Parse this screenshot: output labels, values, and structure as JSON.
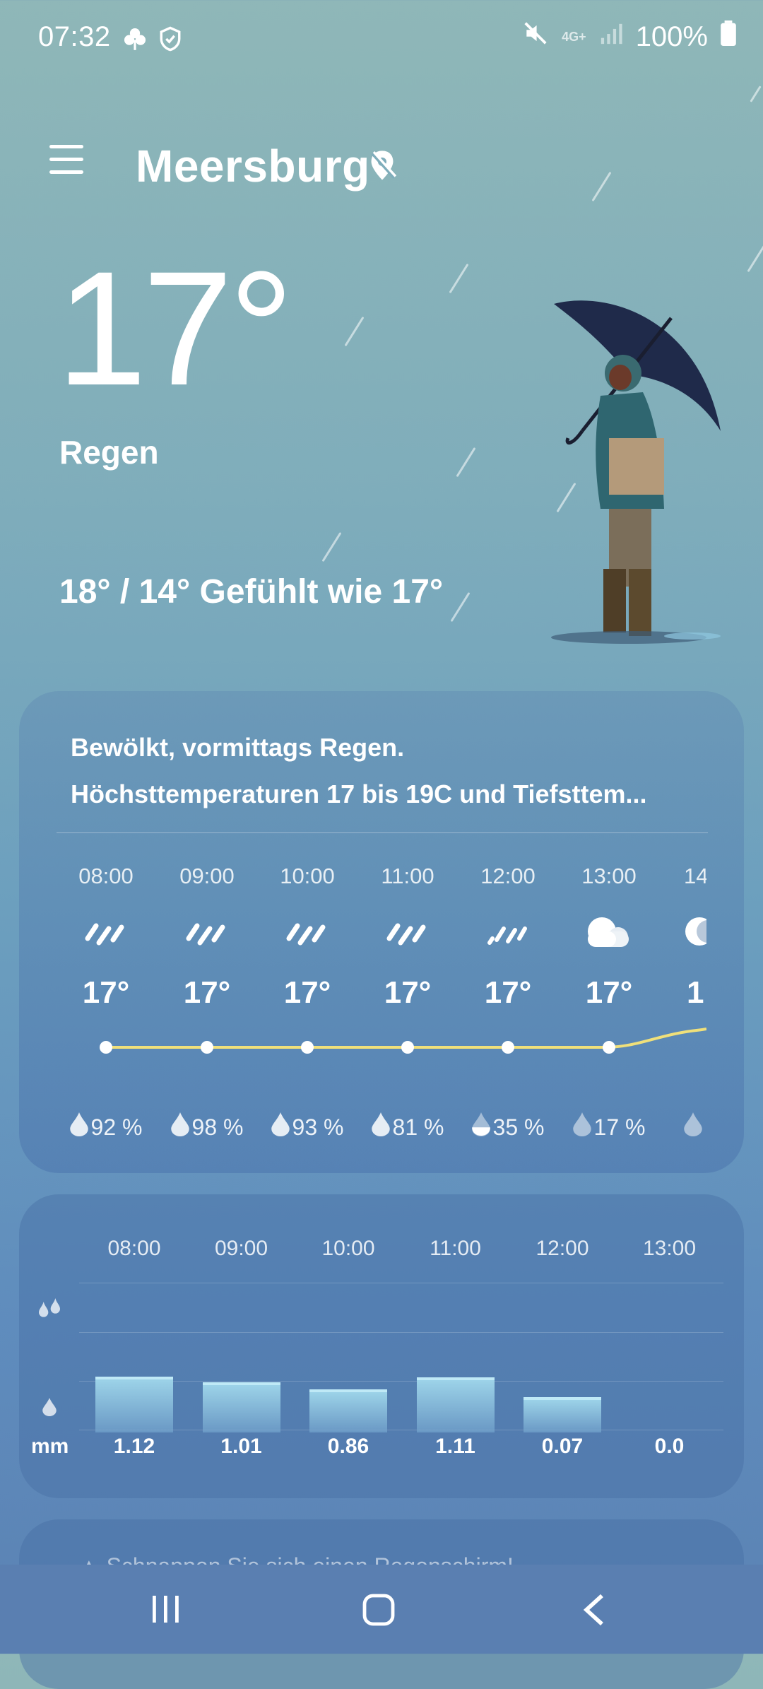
{
  "status": {
    "time": "07:32",
    "battery": "100%",
    "network": "4G+"
  },
  "header": {
    "city": "Meersburg"
  },
  "current": {
    "temp": "17°",
    "condition": "Regen",
    "hilo": "18° / 14° Gefühlt wie 17°"
  },
  "forecast": {
    "summary_line1": "Bewölkt, vormittags Regen.",
    "summary_line2": "Höchsttemperaturen 17 bis 19C und Tiefsttem...",
    "hours": [
      {
        "time": "08:00",
        "temp": "17°",
        "precip": "92 %",
        "icon": "rain-icon"
      },
      {
        "time": "09:00",
        "temp": "17°",
        "precip": "98 %",
        "icon": "rain-icon"
      },
      {
        "time": "10:00",
        "temp": "17°",
        "precip": "93 %",
        "icon": "rain-icon"
      },
      {
        "time": "11:00",
        "temp": "17°",
        "precip": "81 %",
        "icon": "rain-icon"
      },
      {
        "time": "12:00",
        "temp": "17°",
        "precip": "35 %",
        "icon": "light-rain-icon"
      },
      {
        "time": "13:00",
        "temp": "17°",
        "precip": "17 %",
        "icon": "cloud-icon"
      },
      {
        "time": "14",
        "temp": "1",
        "precip": "",
        "icon": "partly-cloudy-icon"
      }
    ]
  },
  "rainfall": {
    "unit": "mm",
    "items": [
      {
        "time": "08:00",
        "value": "1.12",
        "amount": 1.12
      },
      {
        "time": "09:00",
        "value": "1.01",
        "amount": 1.01
      },
      {
        "time": "10:00",
        "value": "0.86",
        "amount": 0.86
      },
      {
        "time": "11:00",
        "value": "1.11",
        "amount": 1.11
      },
      {
        "time": "12:00",
        "value": "0.07",
        "amount": 0.07
      },
      {
        "time": "13:00",
        "value": "0.0",
        "amount": 0.0
      }
    ]
  },
  "tip": {
    "text": "Schnappen Sie sich einen Regenschirm!"
  },
  "colors": {
    "line": "#f0e07a",
    "bar_top": "#bfe9f6"
  }
}
